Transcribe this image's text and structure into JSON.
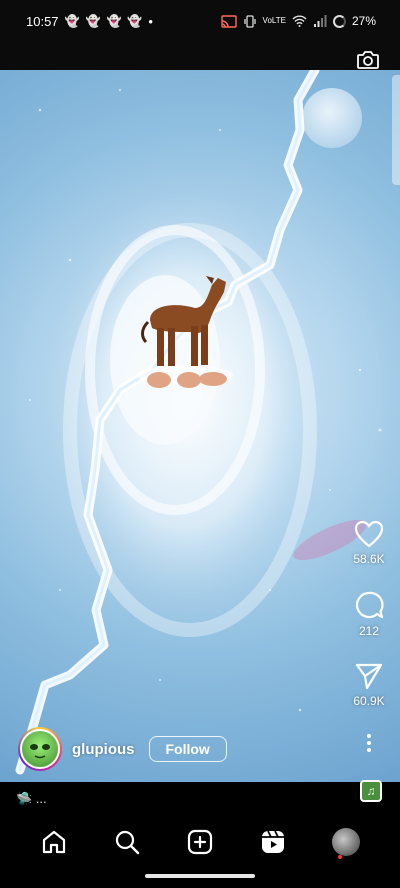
{
  "status_bar": {
    "time": "10:57",
    "notifications": [
      "ghost-icon",
      "ghost-icon",
      "ghost-icon",
      "ghost-icon"
    ],
    "dot": "•",
    "network": "VoLTE",
    "battery_percent": "27%"
  },
  "reel": {
    "likes": "58.6K",
    "comments": "212",
    "shares": "60.9K",
    "username": "glupious",
    "follow_label": "Follow",
    "caption": "🛸 ..."
  },
  "nav": {
    "items": [
      "home-icon",
      "search-icon",
      "create-icon",
      "reels-icon",
      "profile-avatar"
    ],
    "active": "reels-icon"
  },
  "colors": {
    "sky": "#8fbfe0",
    "lightning": "#ffffff",
    "follow_border": "#ffffff"
  }
}
